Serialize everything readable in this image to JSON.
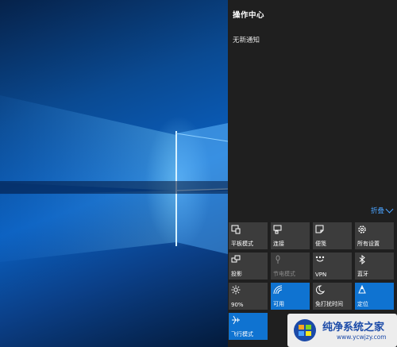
{
  "action_center": {
    "title": "操作中心",
    "no_notifications": "无新通知",
    "collapse_label": "折叠"
  },
  "tiles": [
    {
      "label": "平板模式",
      "icon": "tablet-mode-icon",
      "state": "off"
    },
    {
      "label": "连接",
      "icon": "connect-icon",
      "state": "off"
    },
    {
      "label": "便笺",
      "icon": "note-icon",
      "state": "off"
    },
    {
      "label": "所有设置",
      "icon": "gear-icon",
      "state": "off"
    },
    {
      "label": "投影",
      "icon": "project-icon",
      "state": "off"
    },
    {
      "label": "节电模式",
      "icon": "battery-saver-icon",
      "state": "disabled"
    },
    {
      "label": "VPN",
      "icon": "vpn-icon",
      "state": "off"
    },
    {
      "label": "蓝牙",
      "icon": "bluetooth-icon",
      "state": "off"
    },
    {
      "label": "90%",
      "icon": "brightness-icon",
      "state": "off"
    },
    {
      "label": "可用",
      "icon": "wifi-icon",
      "state": "on"
    },
    {
      "label": "免打扰时间",
      "icon": "quiet-hours-icon",
      "state": "off"
    },
    {
      "label": "定位",
      "icon": "location-icon",
      "state": "on"
    },
    {
      "label": "飞行模式",
      "icon": "airplane-icon",
      "state": "on"
    }
  ],
  "watermark": {
    "title": "纯净系统之家",
    "url": "www.ycwjzy.com"
  },
  "colors": {
    "panel_bg": "#1f1f1f",
    "tile_off": "#3c3c3c",
    "tile_on": "#0f73d1",
    "accent_link": "#4aa3ff"
  }
}
